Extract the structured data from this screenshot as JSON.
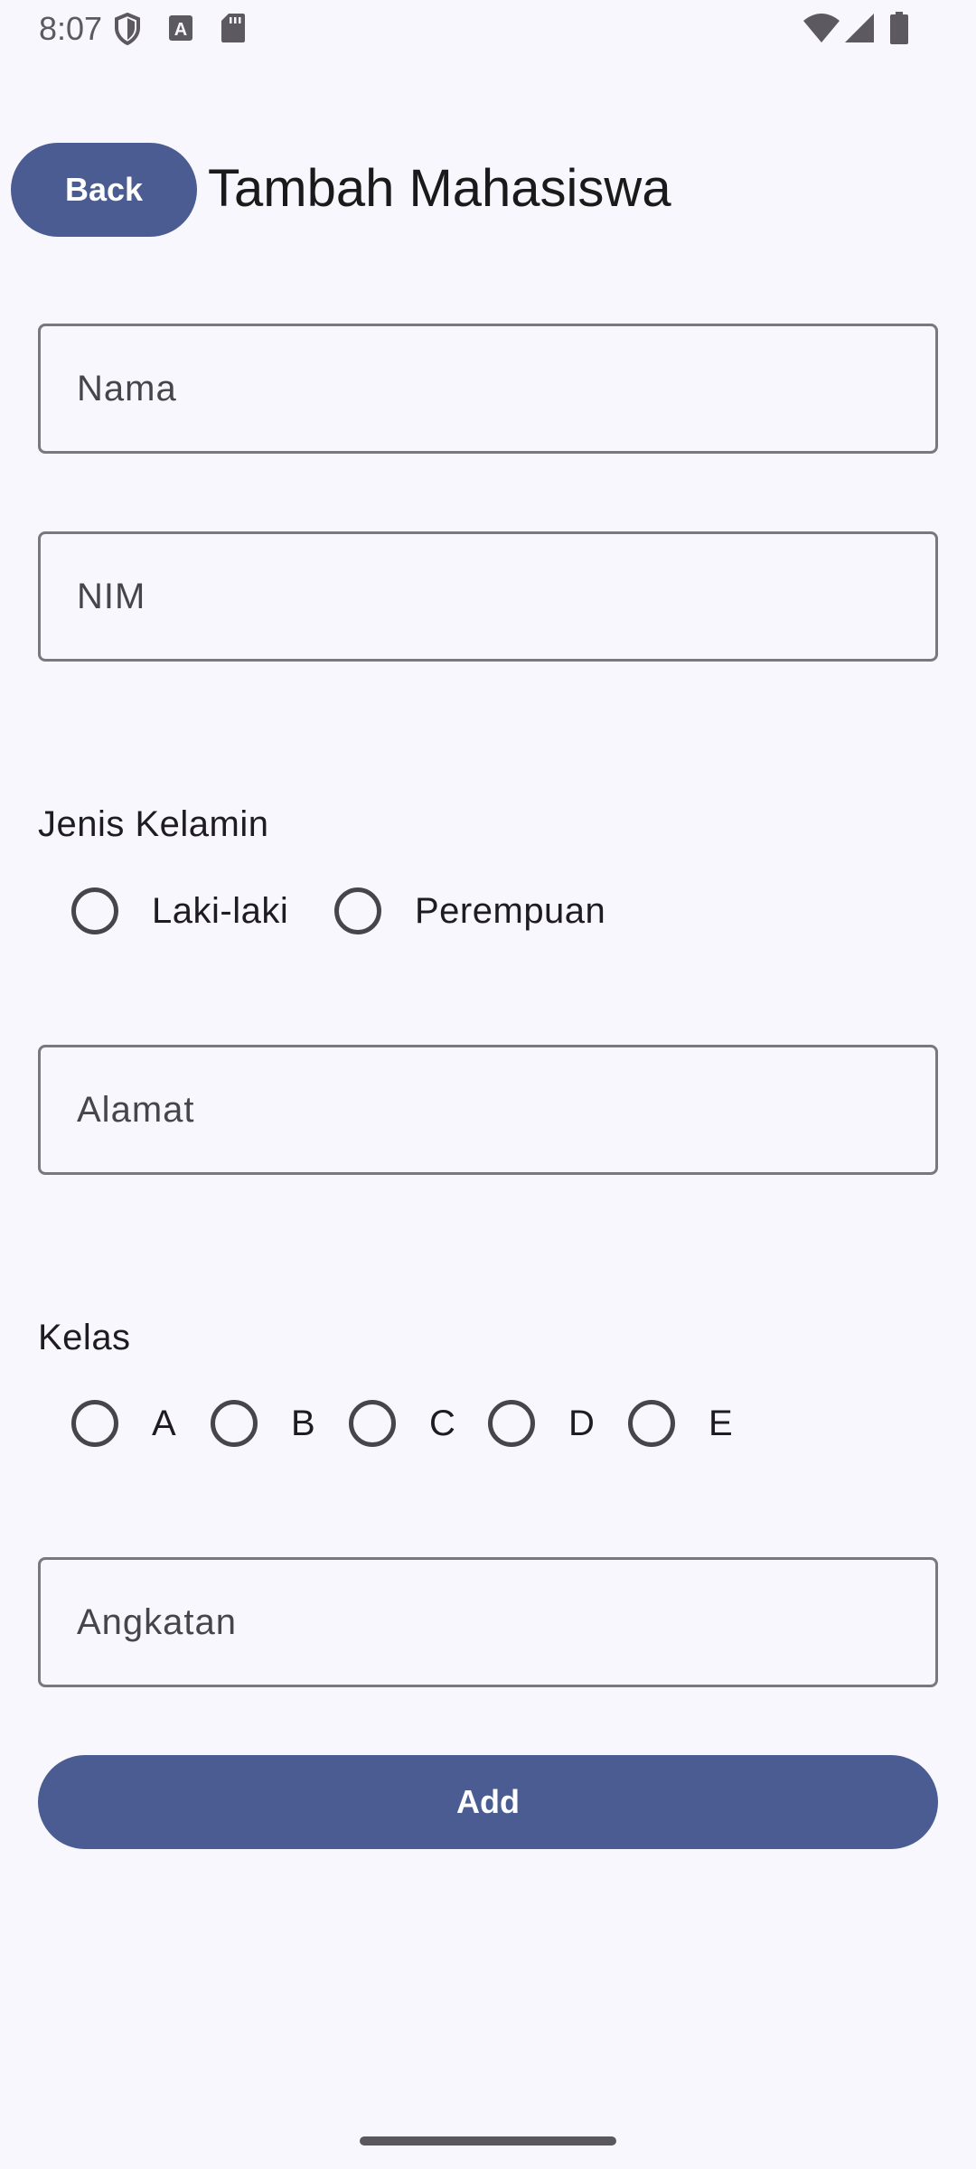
{
  "status_bar": {
    "time": "8:07",
    "icons": [
      "shield-icon",
      "font-a-icon",
      "sd-card-icon",
      "wifi-icon",
      "signal-icon",
      "battery-icon"
    ]
  },
  "header": {
    "back_label": "Back",
    "title": "Tambah Mahasiswa"
  },
  "form": {
    "nama": {
      "placeholder": "Nama",
      "value": ""
    },
    "nim": {
      "placeholder": "NIM",
      "value": ""
    },
    "gender": {
      "label": "Jenis Kelamin",
      "options": [
        "Laki-laki",
        "Perempuan"
      ],
      "selected": null
    },
    "alamat": {
      "placeholder": "Alamat",
      "value": ""
    },
    "kelas": {
      "label": "Kelas",
      "options": [
        "A",
        "B",
        "C",
        "D",
        "E"
      ],
      "selected": null
    },
    "angkatan": {
      "placeholder": "Angkatan",
      "value": ""
    },
    "add_label": "Add"
  },
  "colors": {
    "background": "#F8F7FD",
    "primary": "#4A5C92",
    "outline": "#7A777F",
    "on_surface": "#1F1B22"
  }
}
